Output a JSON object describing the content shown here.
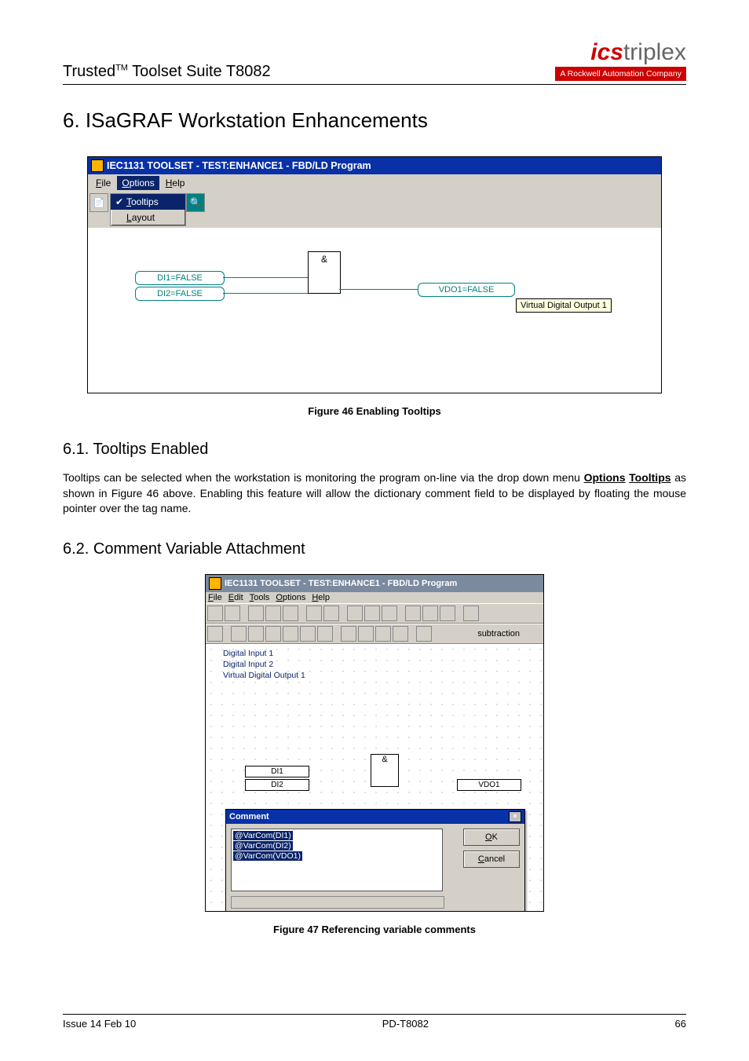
{
  "header": {
    "left_prefix": "Trusted",
    "left_tm": "TM",
    "left_suffix": " Toolset Suite T8082",
    "logo_ics": "ics",
    "logo_triplex": "triplex",
    "logo_sub_bold": "A Rockwell Automation ",
    "logo_sub_rest": "Company"
  },
  "h1": "6. ISaGRAF Workstation Enhancements",
  "ss1": {
    "title": "IEC1131 TOOLSET - TEST:ENHANCE1 - FBD/LD Program",
    "menu": {
      "file": "File",
      "options": "Options",
      "help": "Help"
    },
    "dropdown": {
      "tooltips": "Tooltips",
      "layout": "Layout"
    },
    "di1": "DI1=FALSE",
    "di2": "DI2=FALSE",
    "gate": "&",
    "vdo1": "VDO1=FALSE",
    "tooltip": "Virtual Digital Output 1"
  },
  "fig46": "Figure 46 Enabling Tooltips",
  "h2a": "6.1. Tooltips Enabled",
  "para1a": "Tooltips can be selected when the workstation is monitoring the program on-line via the drop down menu ",
  "para1b": "Options",
  "para1c": " ",
  "para1d": "Tooltips",
  "para1e": " as shown in Figure 46 above. Enabling this feature will allow the dictionary comment field to be displayed by floating the mouse pointer over the tag name.",
  "h2b": "6.2. Comment Variable Attachment",
  "ss2": {
    "title": "IEC1131 TOOLSET - TEST:ENHANCE1 - FBD/LD Program",
    "menu": {
      "file": "File",
      "edit": "Edit",
      "tools": "Tools",
      "options": "Options",
      "help": "Help"
    },
    "subtraction": "subtraction",
    "vars": {
      "v1": "Digital Input 1",
      "v2": "Digital Input 2",
      "v3": "Virtual Digital Output 1"
    },
    "di1": "DI1",
    "di2": "DI2",
    "gate": "&",
    "vdo1": "VDO1",
    "comment": {
      "title": "Comment",
      "l1": "@VarCom(DI1)",
      "l2": "@VarCom(DI2)",
      "l3": "@VarCom(VDO1)",
      "ok": "OK",
      "cancel": "Cancel"
    }
  },
  "fig47": "Figure 47 Referencing variable comments",
  "footer": {
    "left": "Issue 14 Feb 10",
    "center": "PD-T8082",
    "right": "66"
  }
}
